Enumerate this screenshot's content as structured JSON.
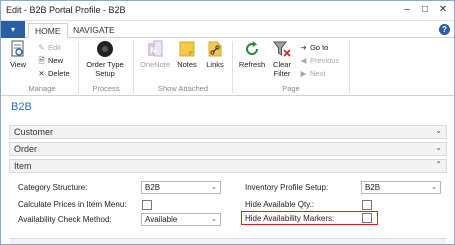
{
  "window": {
    "title": "Edit - B2B Portal Profile - B2B",
    "minimize_icon": "minimize-icon",
    "maximize_icon": "maximize-icon",
    "close_icon": "close-icon"
  },
  "ribbon_tabs": {
    "app_button_glyph": "▾",
    "tabs": [
      {
        "label": "HOME",
        "active": true
      },
      {
        "label": "NAVIGATE",
        "active": false
      }
    ],
    "help_glyph": "?"
  },
  "ribbon": {
    "groups": [
      {
        "label": "Manage"
      },
      {
        "label": "Process"
      },
      {
        "label": "Show Attached"
      },
      {
        "label": "Page"
      }
    ],
    "view_label": "View",
    "edit_label": "Edit",
    "new_label": "New",
    "delete_label": "Delete",
    "order_type_setup_label": "Order Type Setup",
    "onenote_label": "OneNote",
    "notes_label": "Notes",
    "links_label": "Links",
    "refresh_label": "Refresh",
    "clear_filter_label": "Clear Filter",
    "go_to_label": "Go to",
    "previous_label": "Previous",
    "next_label": "Next"
  },
  "page": {
    "title": "B2B"
  },
  "sections": [
    {
      "label": "Customer",
      "expanded": false,
      "chevron": "⌄"
    },
    {
      "label": "Order",
      "expanded": false,
      "chevron": "⌄"
    },
    {
      "label": "Item",
      "expanded": true,
      "chevron": "⌃"
    }
  ],
  "item_fields": {
    "category_structure": {
      "label": "Category Structure:",
      "value": "B2B"
    },
    "calculate_prices": {
      "label": "Calculate Prices in Item Menu:",
      "checked": false
    },
    "availability_check": {
      "label": "Availability Check Method:",
      "value": "Available"
    },
    "inventory_profile": {
      "label": "Inventory Profile Setup:",
      "value": "B2B"
    },
    "hide_available_qty": {
      "label": "Hide Available Qty.:",
      "checked": false
    },
    "hide_availability_markers": {
      "label": "Hide Availability Markers:",
      "checked": false
    }
  },
  "colors": {
    "accent": "#2a5da8",
    "page_title": "#2a6fc0",
    "highlight": "#dd2222"
  }
}
